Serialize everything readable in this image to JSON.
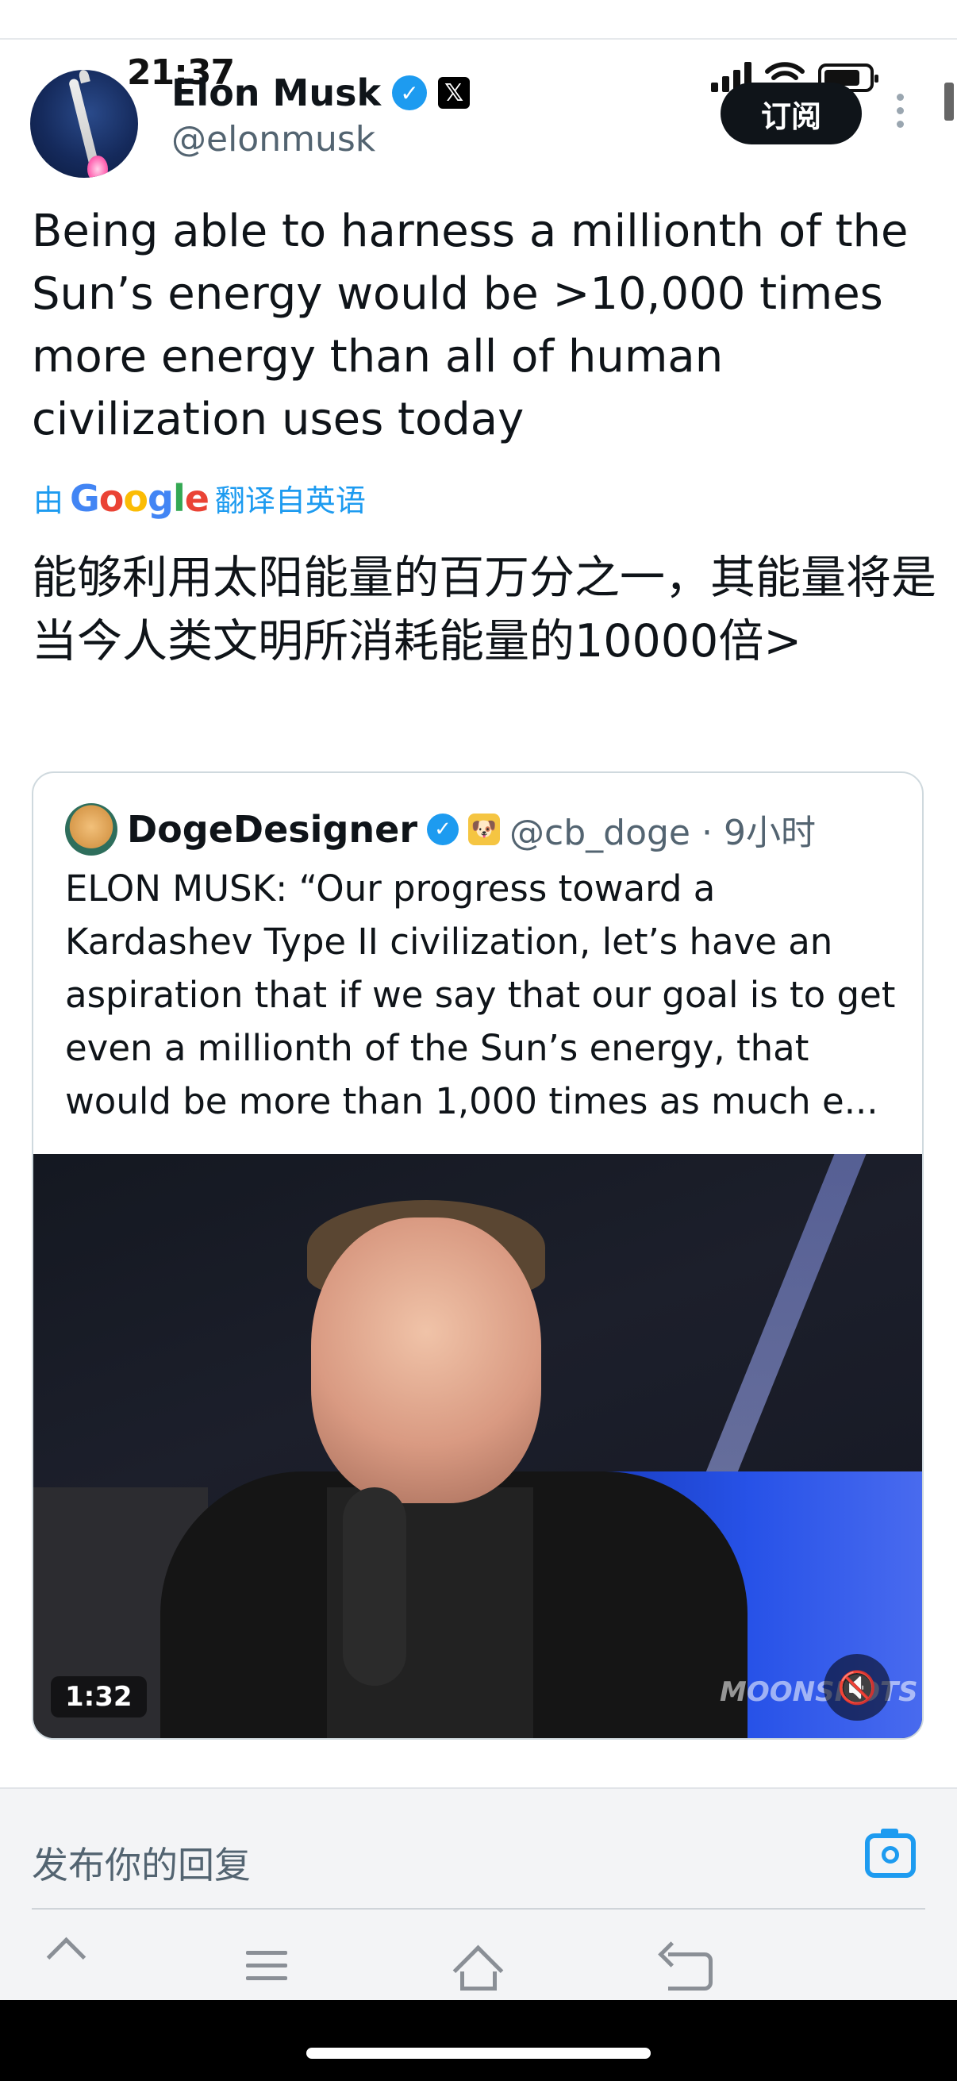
{
  "status": {
    "time": "21:37"
  },
  "author": {
    "name": "Elon Musk",
    "handle": "@elonmusk",
    "verified_icon": "✓",
    "x_badge": "𝕏",
    "subscribe_label": "订阅"
  },
  "tweet": {
    "text": "Being able to harness a millionth of the Sun’s energy would be >10,000 times more energy than all of human civilization uses today",
    "translate_prefix": "由",
    "translate_brand": [
      "G",
      "o",
      "o",
      "g",
      "l",
      "e"
    ],
    "translate_suffix": "翻译自英语",
    "translated_text": "能够利用太阳能量的百万分之一，其能量将是当今人类文明所消耗能量的10000倍>"
  },
  "quote": {
    "name": "DogeDesigner",
    "verified_icon": "✓",
    "emoji_badge": "🐶",
    "handle_time": "@cb_doge · 9小时",
    "text": "ELON MUSK: “Our progress toward a Kardashev Type II civilization, let’s have an aspiration that if we say that our goal is to get even a millionth of the Sun’s energy, that would be more than 1,000 times as much e...",
    "video": {
      "duration": "1:32",
      "mute_icon": "🔇",
      "watermark": "MOONSHOTS"
    }
  },
  "reply": {
    "placeholder": "发布你的回复"
  },
  "colors": {
    "accent": "#1d9bf0",
    "text": "#0f1419",
    "secondary": "#536471"
  }
}
